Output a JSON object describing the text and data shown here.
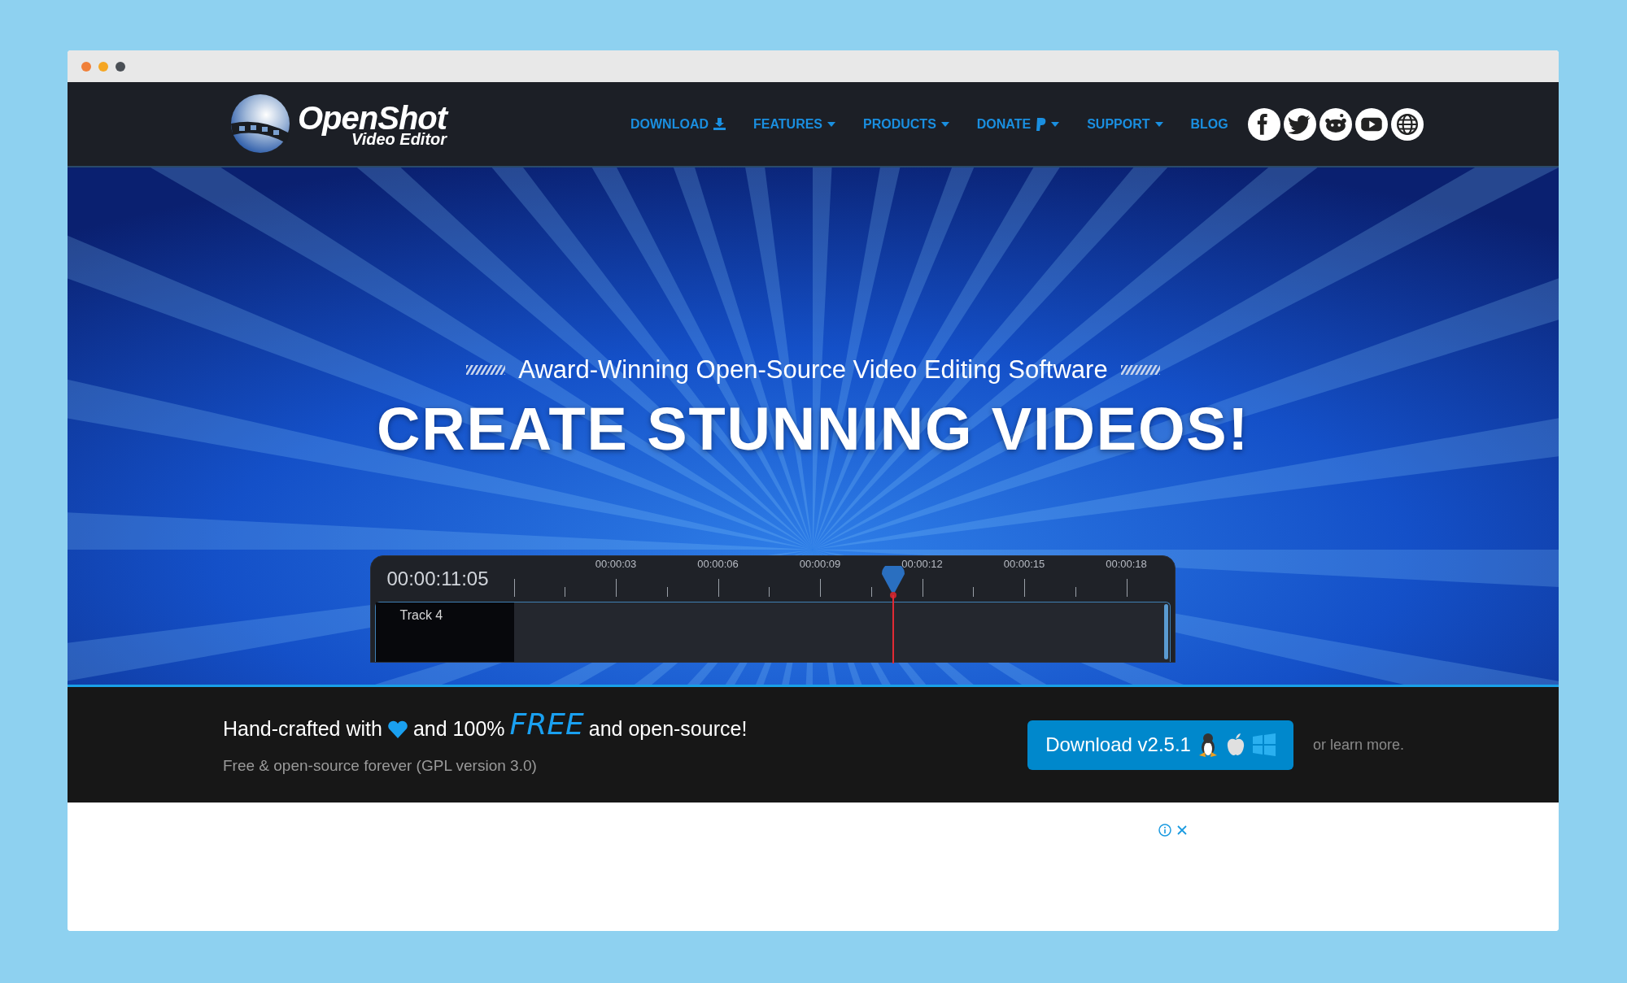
{
  "window_controls": [
    {
      "color": "#f0803a"
    },
    {
      "color": "#f5a623"
    },
    {
      "color": "#4a4f55"
    }
  ],
  "logo": {
    "name": "OpenShot",
    "subtitle": "Video Editor"
  },
  "nav": [
    {
      "label": "DOWNLOAD",
      "kind": "download"
    },
    {
      "label": "FEATURES",
      "kind": "dropdown"
    },
    {
      "label": "PRODUCTS",
      "kind": "dropdown"
    },
    {
      "label": "DONATE",
      "kind": "donate"
    },
    {
      "label": "SUPPORT",
      "kind": "dropdown"
    },
    {
      "label": "BLOG",
      "kind": "link"
    }
  ],
  "social": [
    {
      "kind": "facebook"
    },
    {
      "kind": "twitter"
    },
    {
      "kind": "reddit"
    },
    {
      "kind": "youtube"
    },
    {
      "kind": "globe"
    }
  ],
  "hero": {
    "tagline": "Award-Winning Open-Source Video Editing Software",
    "title": "CREATE STUNNING VIDEOS!",
    "timeline": {
      "timecode": "00:00:11:05",
      "ruler": [
        "00:00:03",
        "00:00:06",
        "00:00:09",
        "00:00:12",
        "00:00:15",
        "00:00:18"
      ],
      "track": "Track 4"
    }
  },
  "promo": {
    "before_heart": "Hand-crafted with",
    "after_heart": "and 100%",
    "free": "FREE",
    "ending": "and open-source!",
    "subline": "Free & open-source forever (GPL version 3.0)",
    "button": "Download v2.5.1",
    "learn_more": "or learn more."
  }
}
